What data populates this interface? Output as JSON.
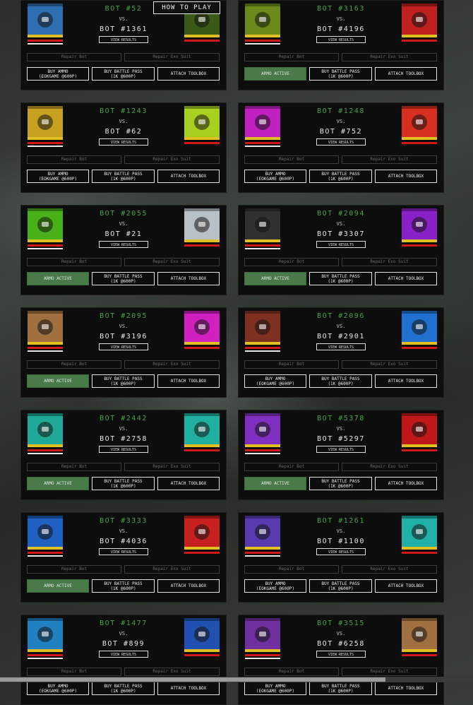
{
  "how_to_play": "HOW TO PLAY",
  "labels": {
    "vs": "VS.",
    "results": "VIEW RESULTS",
    "repair_bot": "Repair Bot",
    "repair_exo": "Repair Exo Suit",
    "buy_ammo": "BUY AMMO\n(EOKGAME @600P)",
    "armo_active": "ARMO ACTIVE",
    "buy_pass": "BUY BATTLE PASS\n(1K @600P)",
    "attach": "ATTACH TOOLBOX"
  },
  "colors": {
    "green": "#4aa24a",
    "armo_bg": "#4a7a4a"
  },
  "cards": [
    {
      "title": "BOT #52",
      "opponent": "BOT #1361",
      "left_bg": "#2d6fb0",
      "right_bg": "#3a5a18",
      "a1": "buy_ammo"
    },
    {
      "title": "BOT #3163",
      "opponent": "BOT #4196",
      "left_bg": "#6c8a1a",
      "right_bg": "#c02020",
      "a1": "armo_active"
    },
    {
      "title": "BOT #1243",
      "opponent": "BOT #62",
      "left_bg": "#c8a020",
      "right_bg": "#a8d020",
      "a1": "buy_ammo"
    },
    {
      "title": "BOT #1248",
      "opponent": "BOT #752",
      "left_bg": "#c020c0",
      "right_bg": "#d83020",
      "a1": "buy_ammo"
    },
    {
      "title": "BOT #2055",
      "opponent": "BOT #21",
      "left_bg": "#48b018",
      "right_bg": "#b8c0c8",
      "a1": "armo_active"
    },
    {
      "title": "BOT #2094",
      "opponent": "BOT #3307",
      "left_bg": "#303030",
      "right_bg": "#8a20c8",
      "a1": "armo_active"
    },
    {
      "title": "BOT #2095",
      "opponent": "BOT #3196",
      "left_bg": "#a07040",
      "right_bg": "#d020c0",
      "a1": "armo_active"
    },
    {
      "title": "BOT #2096",
      "opponent": "BOT #2901",
      "left_bg": "#803020",
      "right_bg": "#2070d0",
      "a1": "buy_ammo"
    },
    {
      "title": "BOT #2442",
      "opponent": "BOT #2758",
      "left_bg": "#20a898",
      "right_bg": "#20b0a0",
      "a1": "armo_active"
    },
    {
      "title": "BOT #5378",
      "opponent": "BOT #5297",
      "left_bg": "#8030c0",
      "right_bg": "#c01818",
      "a1": "armo_active"
    },
    {
      "title": "BOT #3333",
      "opponent": "BOT #4036",
      "left_bg": "#2060c0",
      "right_bg": "#c82020",
      "a1": "armo_active"
    },
    {
      "title": "BOT #1261",
      "opponent": "BOT #1100",
      "left_bg": "#5a3ab0",
      "right_bg": "#20b0a8",
      "a1": "buy_ammo"
    },
    {
      "title": "BOT #1477",
      "opponent": "BOT #899",
      "left_bg": "#2080c0",
      "right_bg": "#2050b0",
      "a1": "buy_ammo"
    },
    {
      "title": "BOT #3515",
      "opponent": "BOT #6258",
      "left_bg": "#7030a0",
      "right_bg": "#a07040",
      "a1": "buy_ammo"
    }
  ]
}
